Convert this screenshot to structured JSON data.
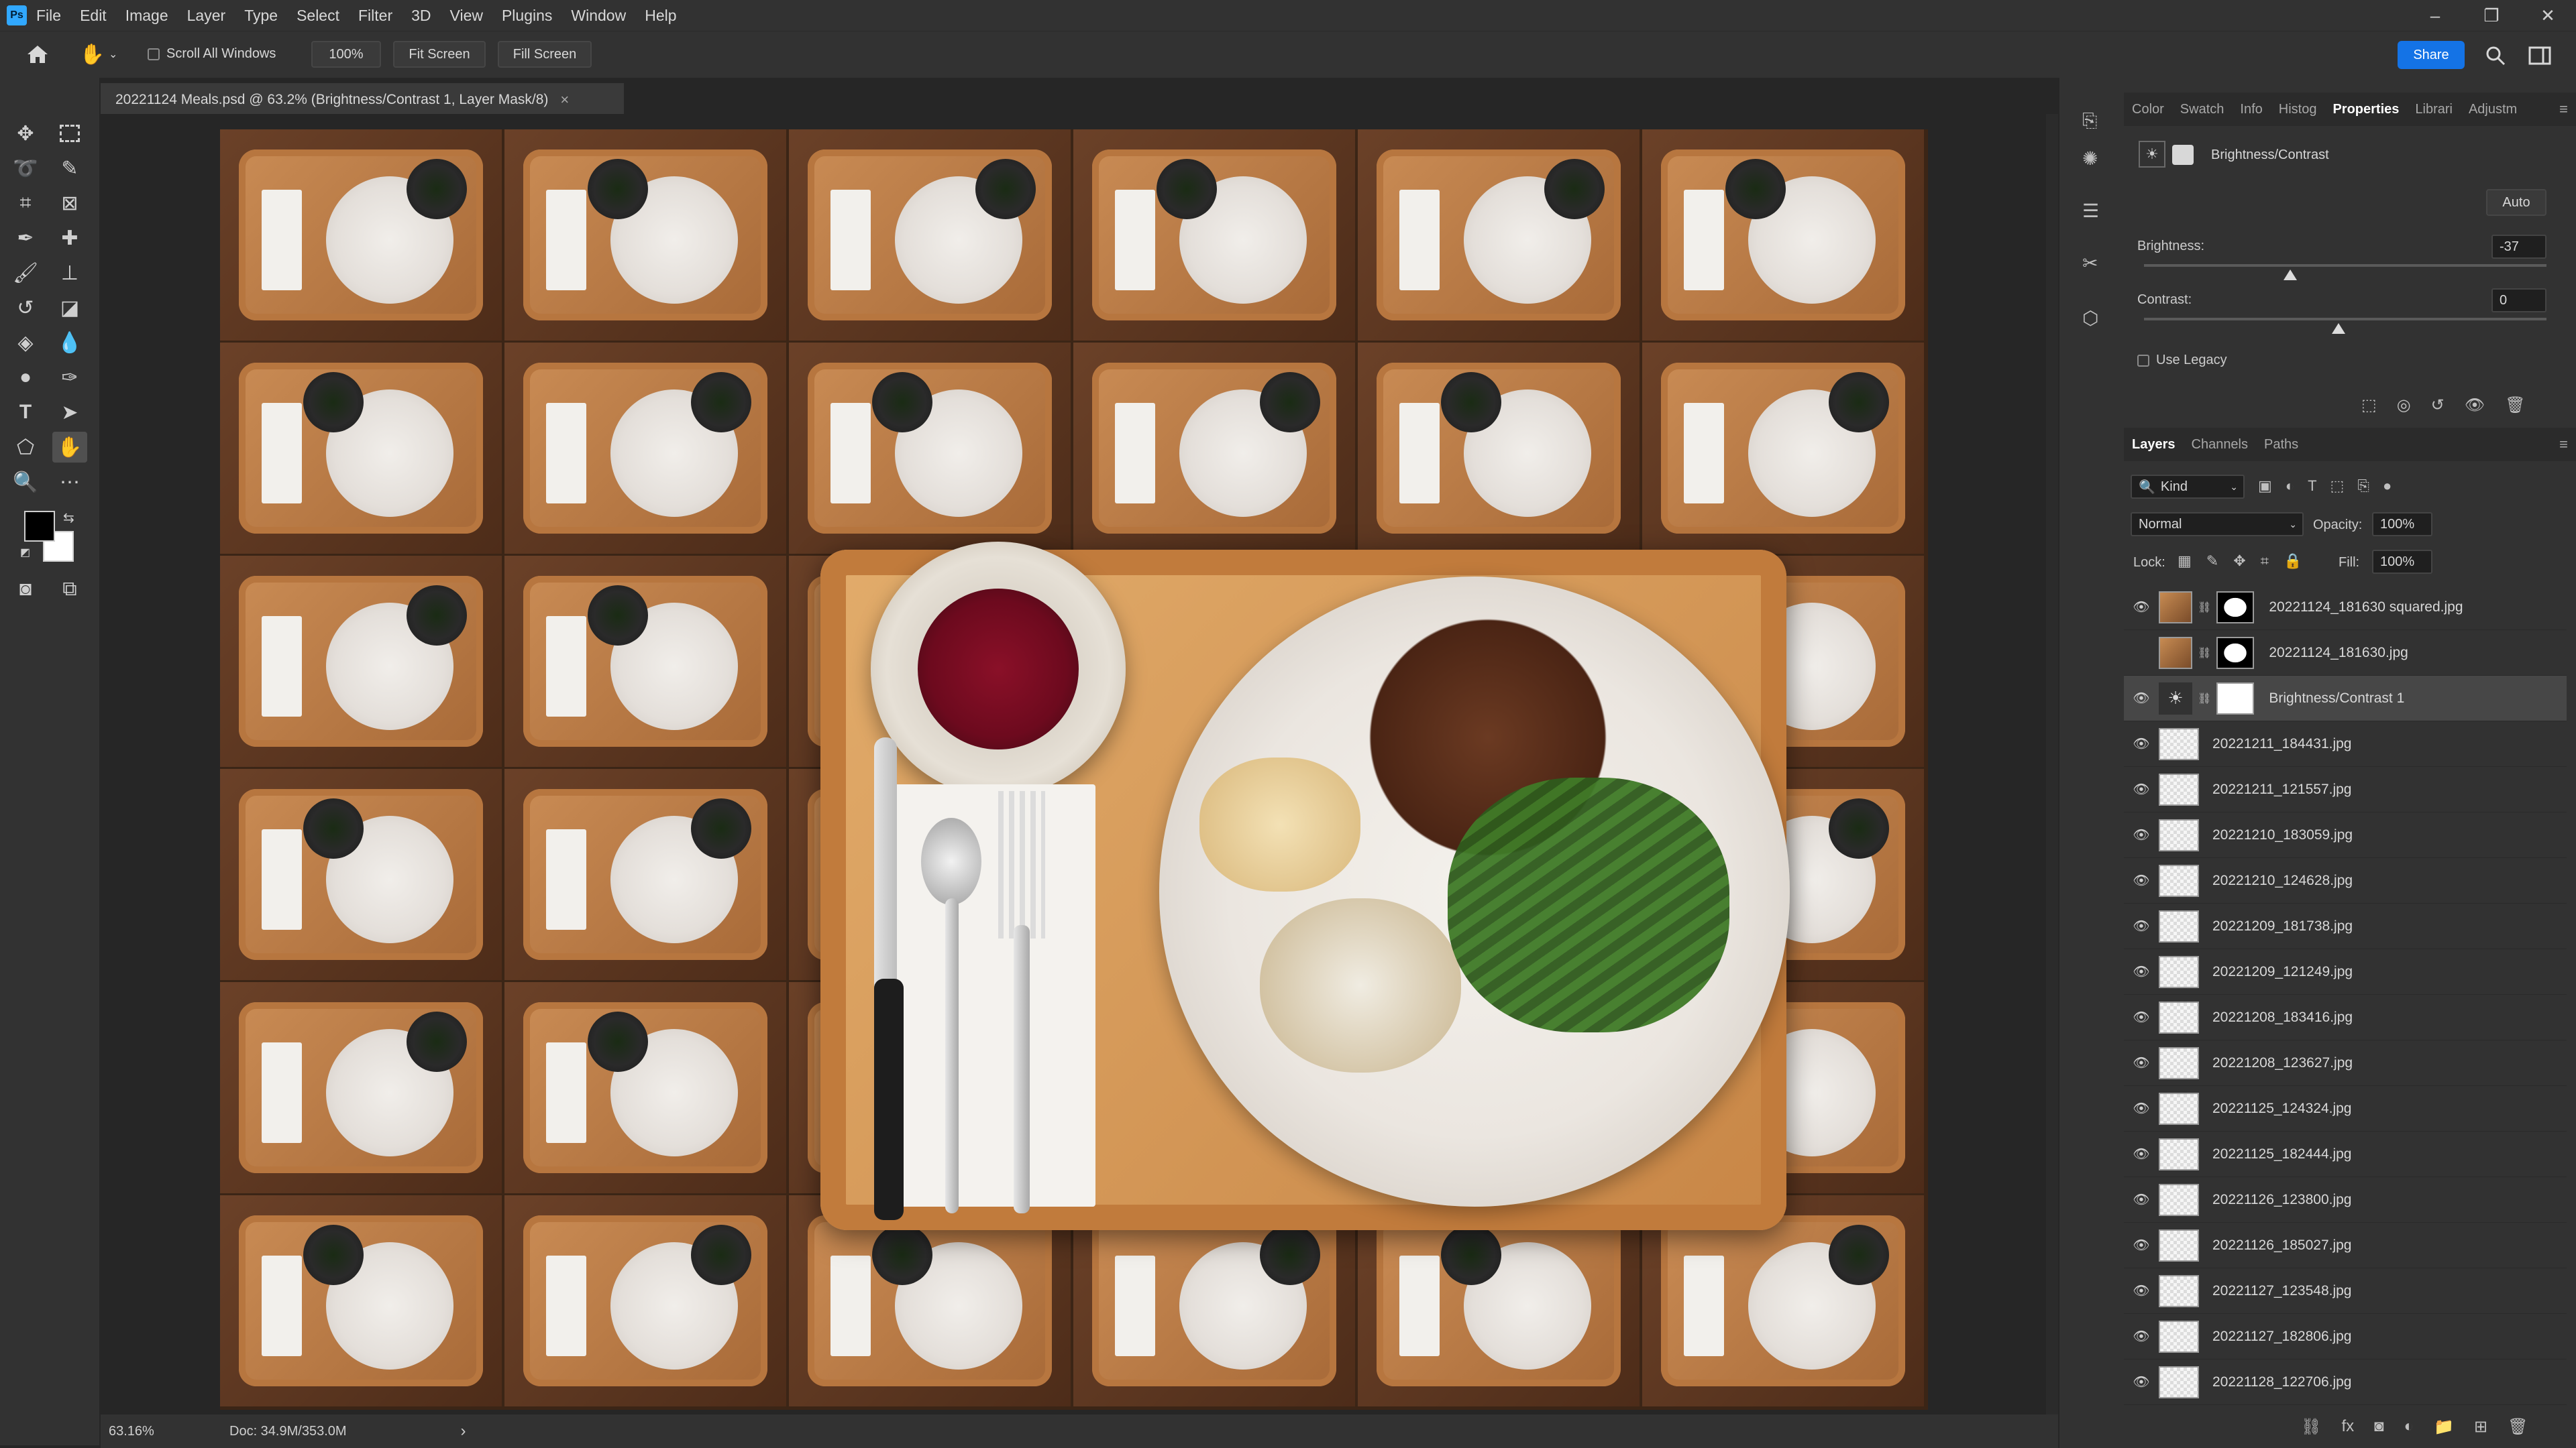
{
  "menu": {
    "logo": "Ps",
    "items": [
      "File",
      "Edit",
      "Image",
      "Layer",
      "Type",
      "Select",
      "Filter",
      "3D",
      "View",
      "Plugins",
      "Window",
      "Help"
    ]
  },
  "window_controls": [
    "–",
    "❐",
    "✕"
  ],
  "options_bar": {
    "scroll_all_windows": "Scroll All Windows",
    "zoom_value": "100%",
    "fit_screen": "Fit Screen",
    "fill_screen": "Fill Screen",
    "share": "Share"
  },
  "document": {
    "tab_title": "20221124 Meals.psd @ 63.2% (Brightness/Contrast 1, Layer Mask/8)",
    "close": "×"
  },
  "status": {
    "zoom": "63.16%",
    "doc": "Doc: 34.9M/353.0M",
    "arrow": "›"
  },
  "properties_panel": {
    "tabs": [
      "Color",
      "Swatch",
      "Info",
      "Histog",
      "Properties",
      "Librari",
      "Adjustm"
    ],
    "active_tab": "Properties",
    "adjustment_title": "Brightness/Contrast",
    "auto_label": "Auto",
    "brightness_label": "Brightness:",
    "brightness_value": "-37",
    "contrast_label": "Contrast:",
    "contrast_value": "0",
    "use_legacy": "Use Legacy"
  },
  "layers_panel": {
    "tabs": [
      "Layers",
      "Channels",
      "Paths"
    ],
    "active_tab": "Layers",
    "kind_label": "Kind",
    "blend_mode": "Normal",
    "opacity_label": "Opacity:",
    "opacity_value": "100%",
    "lock_label": "Lock:",
    "fill_label": "Fill:",
    "fill_value": "100%",
    "layers": [
      {
        "name": "20221124_181630 squared.jpg",
        "visible": true
      },
      {
        "name": "20221124_181630.jpg",
        "visible": false
      },
      {
        "name": "Brightness/Contrast 1",
        "visible": true,
        "selected": true
      },
      {
        "name": "20221211_184431.jpg",
        "visible": true
      },
      {
        "name": "20221211_121557.jpg",
        "visible": true
      },
      {
        "name": "20221210_183059.jpg",
        "visible": true
      },
      {
        "name": "20221210_124628.jpg",
        "visible": true
      },
      {
        "name": "20221209_181738.jpg",
        "visible": true
      },
      {
        "name": "20221209_121249.jpg",
        "visible": true
      },
      {
        "name": "20221208_183416.jpg",
        "visible": true
      },
      {
        "name": "20221208_123627.jpg",
        "visible": true
      },
      {
        "name": "20221125_124324.jpg",
        "visible": true
      },
      {
        "name": "20221125_182444.jpg",
        "visible": true
      },
      {
        "name": "20221126_123800.jpg",
        "visible": true
      },
      {
        "name": "20221126_185027.jpg",
        "visible": true
      },
      {
        "name": "20221127_123548.jpg",
        "visible": true
      },
      {
        "name": "20221127_182806.jpg",
        "visible": true
      },
      {
        "name": "20221128_122706.jpg",
        "visible": true
      }
    ]
  },
  "colors": {
    "accent": "#1473e6",
    "panel_bg": "#323232",
    "canvas_bg": "#262626"
  }
}
